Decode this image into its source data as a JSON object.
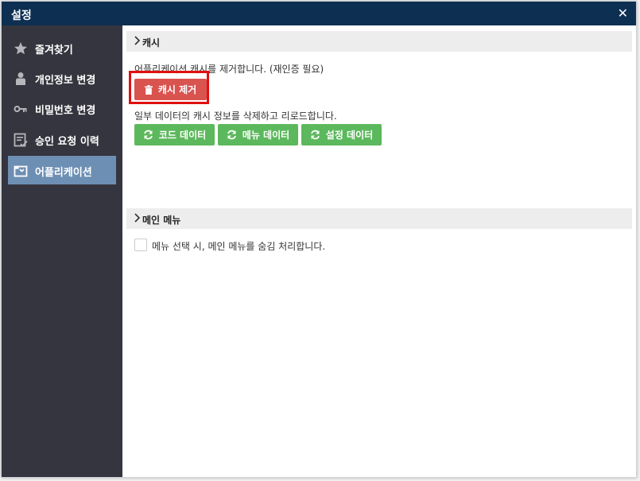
{
  "window": {
    "title": "설정"
  },
  "sidebar": {
    "items": [
      {
        "label": "즐겨찾기",
        "icon": "star-icon"
      },
      {
        "label": "개인정보 변경",
        "icon": "person-icon"
      },
      {
        "label": "비밀번호 변경",
        "icon": "key-icon"
      },
      {
        "label": "승인 요청 이력",
        "icon": "list-check-icon"
      },
      {
        "label": "어플리케이션",
        "icon": "app-window-icon"
      }
    ],
    "active_index": 4
  },
  "cache_section": {
    "title": "캐시",
    "description1": "어플리케이션 캐시를 제거합니다. (재인증 필요)",
    "clear_button": "캐시 제거",
    "description2": "일부 데이터의 캐시 정보를 삭제하고 리로드합니다.",
    "reload_buttons": [
      "코드 데이터",
      "메뉴 데이터",
      "설정 데이터"
    ]
  },
  "main_menu_section": {
    "title": "메인 메뉴",
    "checkbox_label": "메뉴 선택 시, 메인 메뉴를 숨김 처리합니다.",
    "checkbox_checked": false
  },
  "colors": {
    "titlebar": "#0d2f52",
    "sidebar": "#35353f",
    "active_nav": "#6d8fb3",
    "danger": "#d9534f",
    "success": "#5cb85c",
    "highlight": "#e01010"
  }
}
